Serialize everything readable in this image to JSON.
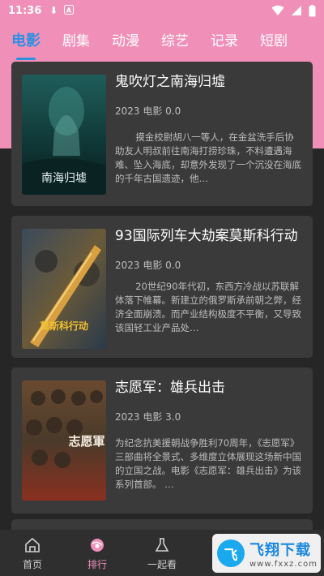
{
  "status_bar": {
    "time": "11:36",
    "icons": [
      "download-icon",
      "a-icon",
      "wifi-icon",
      "signal-icon",
      "battery-icon"
    ]
  },
  "tabs": [
    {
      "label": "电影",
      "active": true
    },
    {
      "label": "剧集",
      "active": false
    },
    {
      "label": "动漫",
      "active": false
    },
    {
      "label": "综艺",
      "active": false
    },
    {
      "label": "记录",
      "active": false
    },
    {
      "label": "短剧",
      "active": false
    }
  ],
  "movies": [
    {
      "title": "鬼吹灯之南海归墟",
      "meta": "2023 电影 0.0",
      "desc": "摸金校尉胡八一等人，在金盆洗手后协助友人明叔前往南海打捞珍珠，不料遭遇海难、坠入海底，却意外发现了一个沉没在海底的千年古国遗迹，他…",
      "poster_text": "南海归墟"
    },
    {
      "title": "93国际列车大劫案莫斯科行动",
      "meta": "2023 电影 0.0",
      "desc": "20世纪90年代初，东西方冷战以苏联解体落下帷幕。新建立的俄罗斯承前朝之弊，经济全面崩溃。而产业结构极度不平衡，又导致该国轻工业产品处…",
      "poster_text": "莫斯科行动"
    },
    {
      "title": "志愿军：雄兵出击",
      "meta": "2023 电影 3.0",
      "desc": "为纪念抗美援朝战争胜利70周年，《志愿军》三部曲将全景式、多维度立体展现这场新中国的立国之战。电影《志愿军：雄兵出击》为该系列首部。 …",
      "poster_text": "志愿軍"
    }
  ],
  "bottom_nav": [
    {
      "label": "首页",
      "icon": "home-icon",
      "active": false
    },
    {
      "label": "排行",
      "icon": "ranking-icon",
      "active": true
    },
    {
      "label": "一起看",
      "icon": "watch-together-icon",
      "active": false
    },
    {
      "label": "",
      "icon": "",
      "active": false
    },
    {
      "label": "",
      "icon": "",
      "active": false
    }
  ],
  "watermark": {
    "logo": "飞",
    "name": "飞翔下载",
    "url": "www.fxxz.com"
  },
  "colors": {
    "accent": "#2d8fe3",
    "pink": "#f090b8",
    "card": "#3a3a3a",
    "bg": "#262626"
  }
}
